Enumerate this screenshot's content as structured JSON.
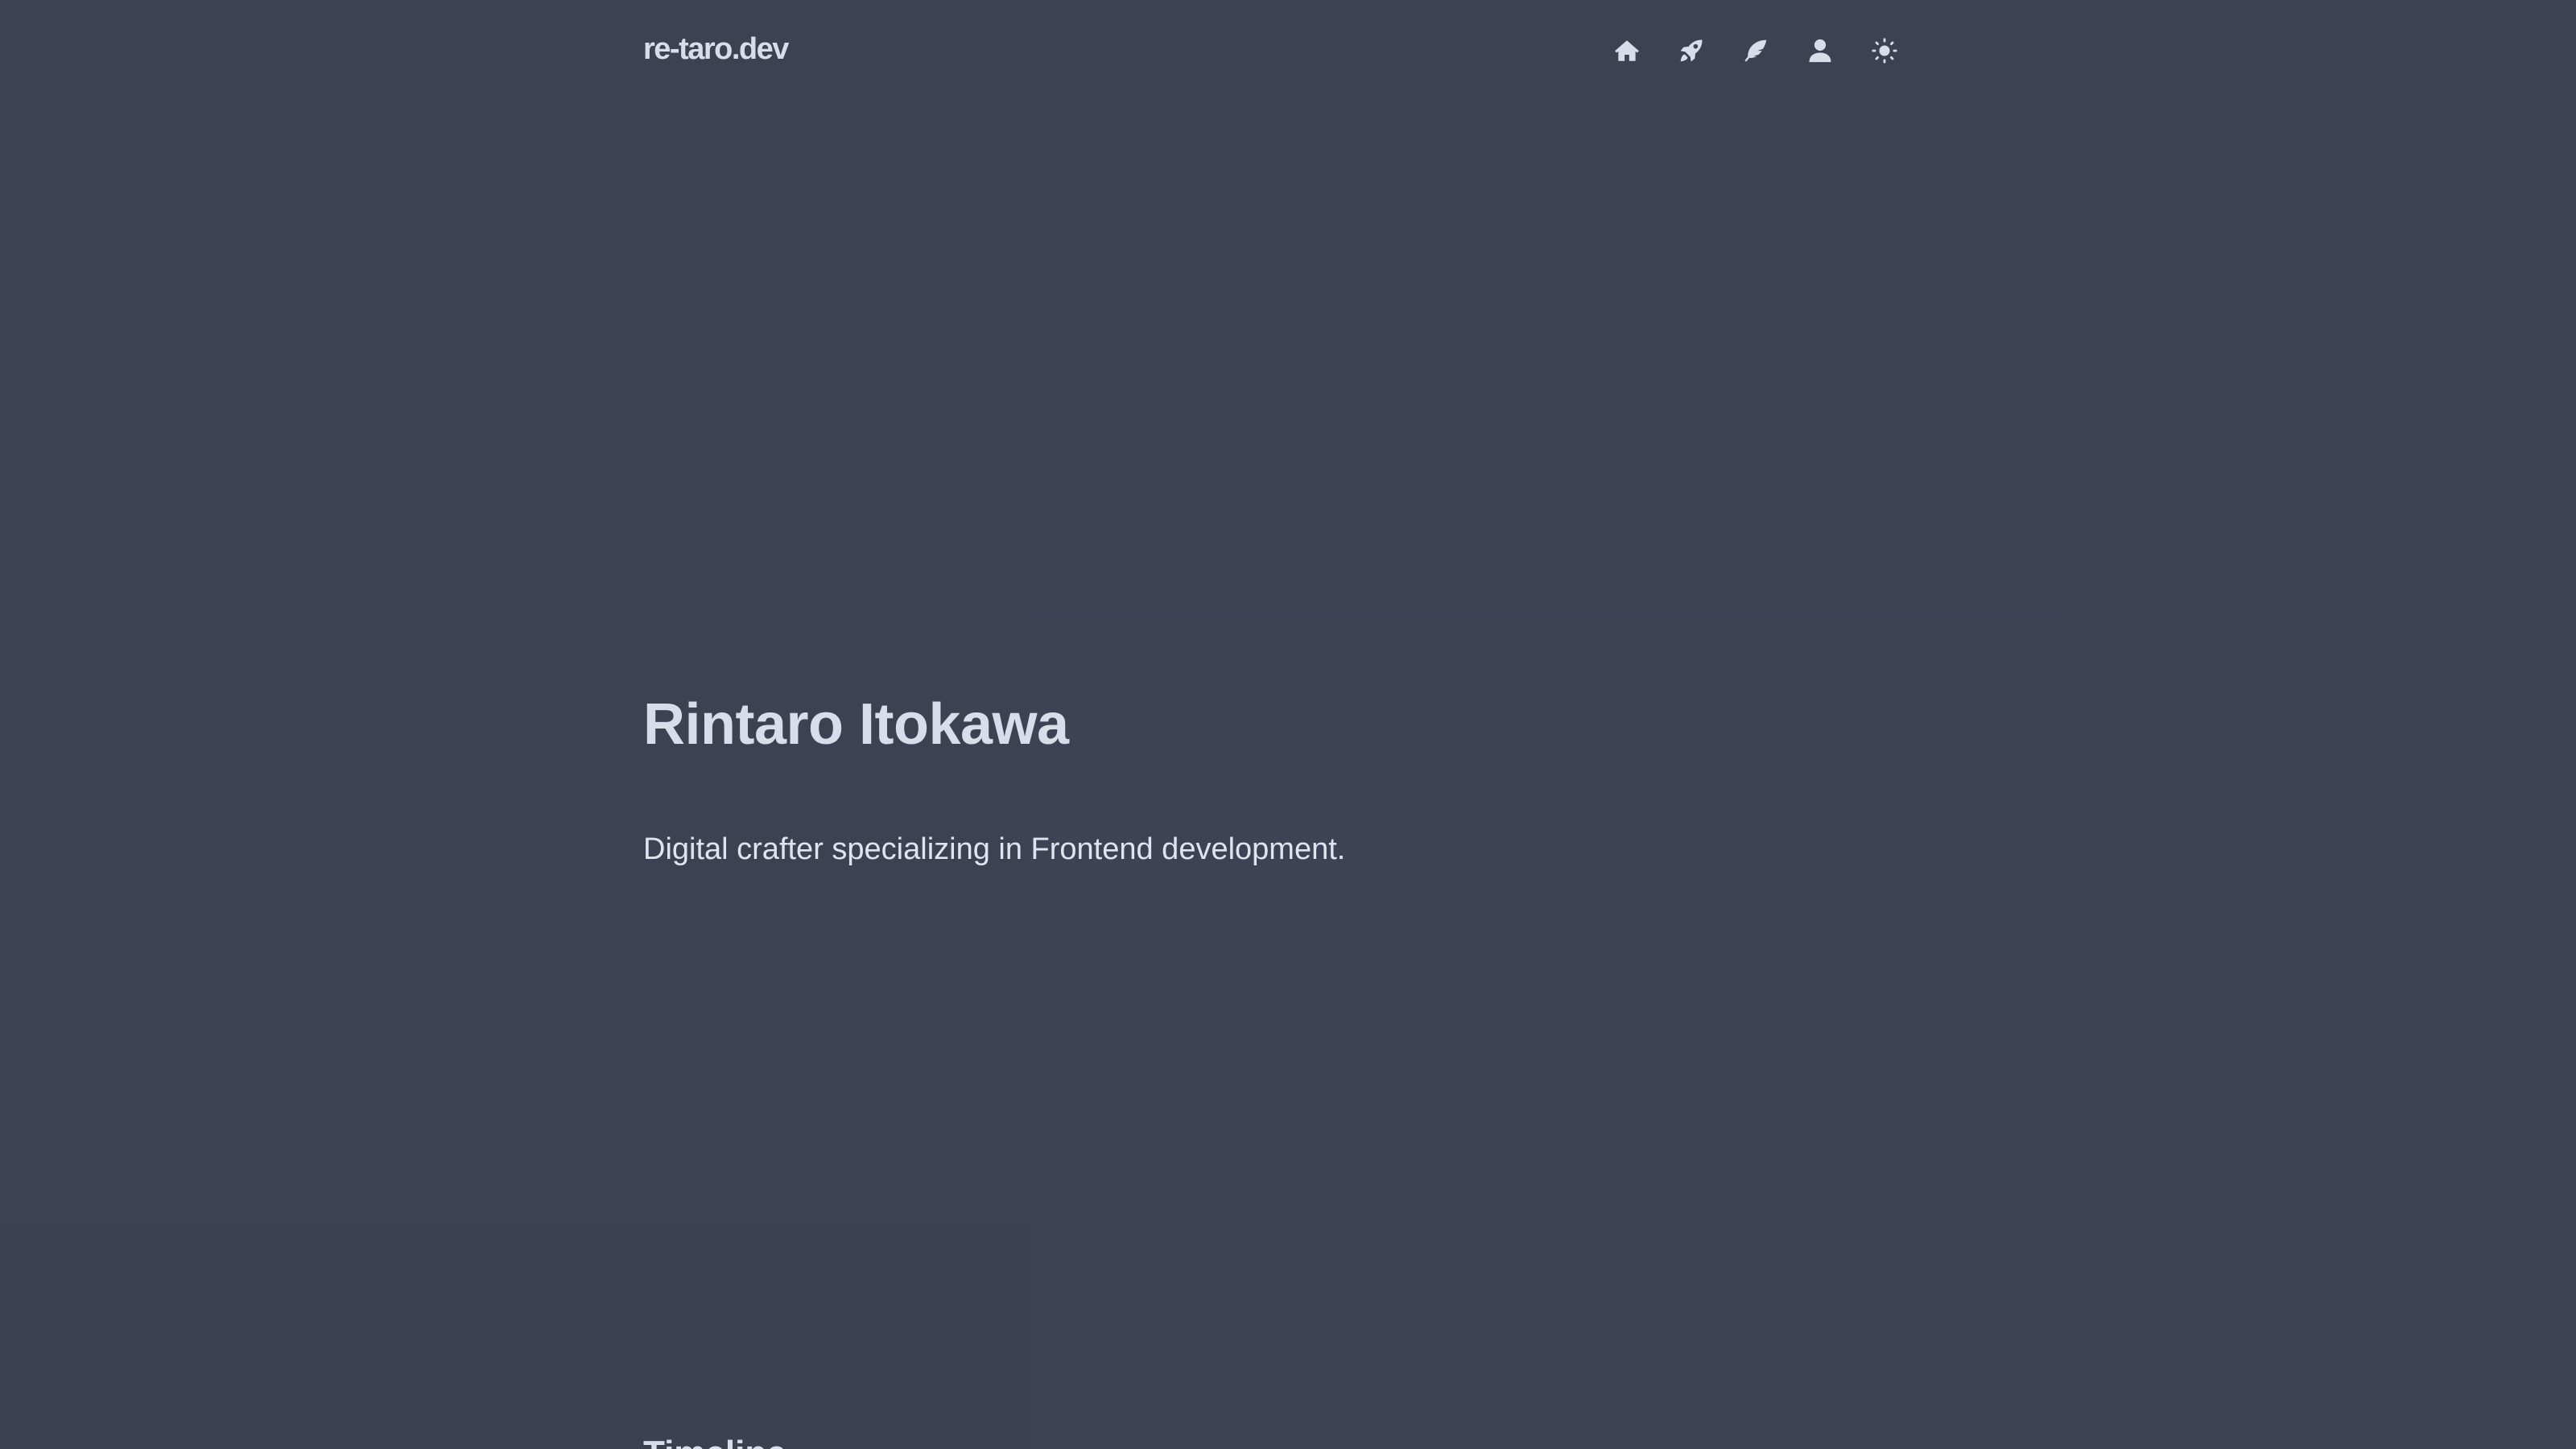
{
  "header": {
    "site_title": "re-taro.dev",
    "nav": [
      {
        "icon": "home-icon",
        "label": "Home"
      },
      {
        "icon": "rocket-icon",
        "label": "Projects"
      },
      {
        "icon": "feather-icon",
        "label": "Blog"
      },
      {
        "icon": "user-icon",
        "label": "About"
      },
      {
        "icon": "sun-icon",
        "label": "Toggle theme"
      }
    ]
  },
  "hero": {
    "name": "Rintaro Itokawa",
    "tagline": "Digital crafter specializing in Frontend development."
  },
  "next_section": {
    "heading": "Timeline"
  },
  "colors": {
    "background": "#3c4252",
    "text": "#d8dee9"
  }
}
